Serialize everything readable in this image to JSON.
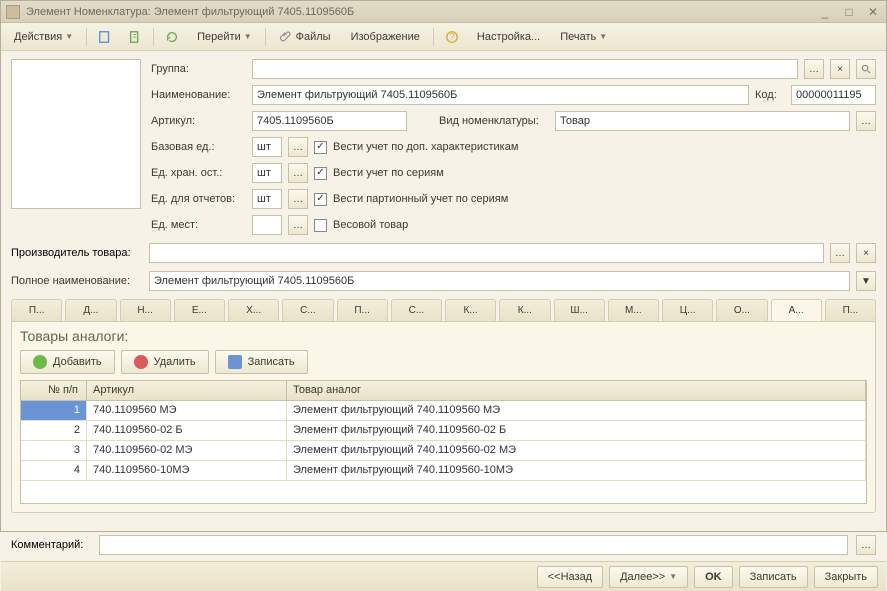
{
  "window": {
    "title": "Элемент Номенклатура:  Элемент фильтрующий 7405.1109560Б"
  },
  "toolbar": {
    "actions": "Действия",
    "goto": "Перейти",
    "files": "Файлы",
    "image": "Изображение",
    "settings": "Настройка...",
    "print": "Печать"
  },
  "fields": {
    "group": {
      "label": "Группа:",
      "value": ""
    },
    "name": {
      "label": "Наименование:",
      "value": "Элемент фильтрующий 7405.1109560Б"
    },
    "code": {
      "label": "Код:",
      "value": "00000011195"
    },
    "article": {
      "label": "Артикул:",
      "value": "7405.1109560Б"
    },
    "nomtype": {
      "label": "Вид номенклатуры:",
      "value": "Товар"
    },
    "baseunit": {
      "label": "Базовая ед.:",
      "value": "шт"
    },
    "storeunit": {
      "label": "Ед. хран. ост.:",
      "value": "шт"
    },
    "reportunit": {
      "label": "Ед. для отчетов:",
      "value": "шт"
    },
    "placeunit": {
      "label": "Ед. мест:",
      "value": ""
    },
    "cb_dop": "Вести учет по доп. характеристикам",
    "cb_series": "Вести учет по сериям",
    "cb_batch": "Вести партионный учет по сериям",
    "cb_weight": "Весовой товар",
    "producer": {
      "label": "Производитель товара:",
      "value": ""
    },
    "fullname": {
      "label": "Полное наименование:",
      "value": "Элемент фильтрующий 7405.1109560Б"
    },
    "comment": {
      "label": "Комментарий:",
      "value": ""
    }
  },
  "tabs": [
    "П...",
    "Д...",
    "Н...",
    "Е...",
    "Х...",
    "С...",
    "П...",
    "С...",
    "К...",
    "К...",
    "Ш...",
    "М...",
    "Ц...",
    "О...",
    "А...",
    "П..."
  ],
  "panel": {
    "title": "Товары аналоги:",
    "add": "Добавить",
    "del": "Удалить",
    "save": "Записать",
    "cols": [
      "№ п/п",
      "Артикул",
      "Товар аналог"
    ],
    "rows": [
      {
        "n": "1",
        "art": "740.1109560 МЭ",
        "name": "Элемент фильтрующий 740.1109560 МЭ"
      },
      {
        "n": "2",
        "art": "740.1109560-02 Б",
        "name": "Элемент фильтрующий 740.1109560-02 Б"
      },
      {
        "n": "3",
        "art": "740.1109560-02 МЭ",
        "name": "Элемент фильтрующий 740.1109560-02 МЭ"
      },
      {
        "n": "4",
        "art": "740.1109560-10МЭ",
        "name": "Элемент фильтрующий 740.1109560-10МЭ"
      }
    ]
  },
  "footer": {
    "back": "<<Назад",
    "next": "Далее>>",
    "ok": "OK",
    "write": "Записать",
    "close": "Закрыть"
  }
}
